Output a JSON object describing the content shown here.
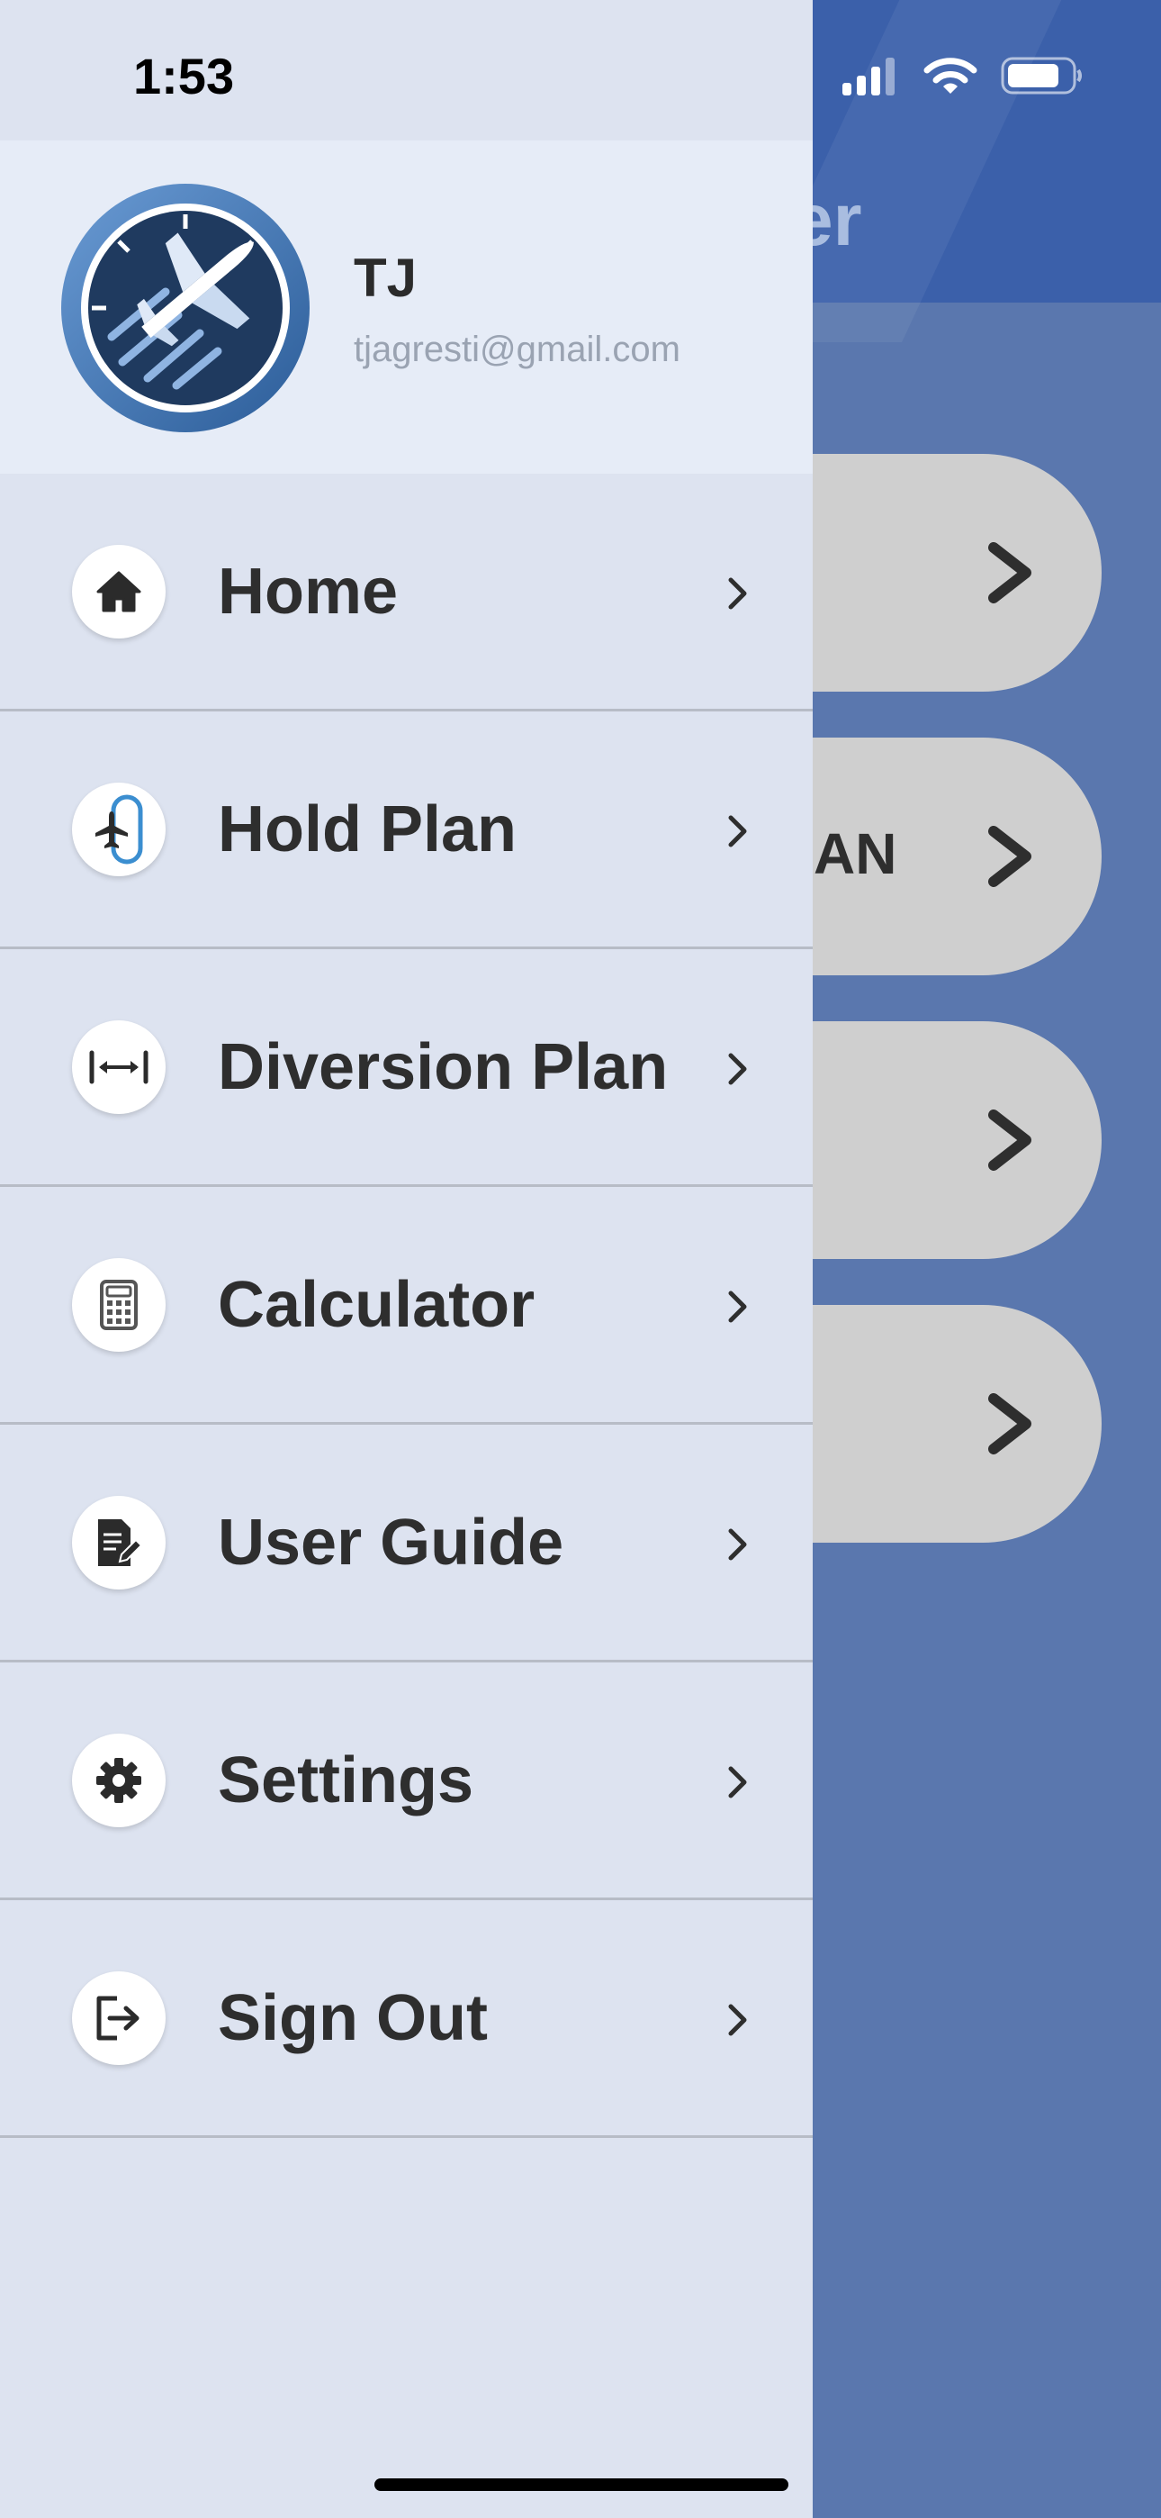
{
  "status_bar": {
    "time": "1:53",
    "icons": [
      "cellular-signal-icon",
      "wifi-icon",
      "battery-icon"
    ]
  },
  "background_app": {
    "title_fragment": "er",
    "tiles": [
      {
        "text": "",
        "chevron": "chevron-right-icon"
      },
      {
        "text": "AN",
        "chevron": "chevron-right-icon"
      },
      {
        "text": "",
        "chevron": "chevron-right-icon"
      },
      {
        "text": "",
        "chevron": "chevron-right-icon"
      }
    ],
    "colors": {
      "header": "#3b60aa",
      "body": "#5a77ae",
      "tile": "#cfcfcf"
    }
  },
  "profile": {
    "name": "TJ",
    "email": "tjagresti@gmail.com",
    "avatar_icon": "airplane-logo-icon"
  },
  "menu": {
    "items": [
      {
        "label": "Home",
        "icon": "home-icon"
      },
      {
        "label": "Hold Plan",
        "icon": "hold-pattern-icon"
      },
      {
        "label": "Diversion Plan",
        "icon": "diversion-arrows-icon"
      },
      {
        "label": "Calculator",
        "icon": "calculator-icon"
      },
      {
        "label": "User Guide",
        "icon": "user-guide-icon"
      },
      {
        "label": "Settings",
        "icon": "gear-icon"
      },
      {
        "label": "Sign Out",
        "icon": "sign-out-icon"
      }
    ]
  },
  "colors": {
    "drawer_bg": "#dde3f0",
    "profile_bg": "#e6ecf7",
    "text": "#2e2e2e",
    "divider": "#b7bcc6",
    "accent": "#3b82c4"
  }
}
